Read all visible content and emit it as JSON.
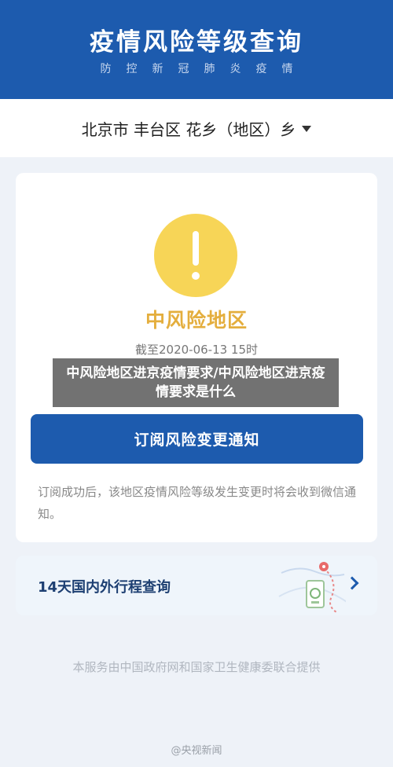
{
  "header": {
    "title": "疫情风险等级查询",
    "subtitle": "防控新冠肺炎疫情"
  },
  "location": {
    "selected": "北京市 丰台区 花乡（地区）乡"
  },
  "risk_card": {
    "level": "中风险地区",
    "as_of": "截至2020-06-13 15时",
    "subscribe_button": "订阅风险变更通知",
    "subscribe_note": "订阅成功后，该地区疫情风险等级发生变更时将会收到微信通知。"
  },
  "trip_card": {
    "label": "14天国内外行程查询"
  },
  "footer": {
    "provider": "本服务由中国政府网和国家卫生健康委联合提供"
  },
  "watermark": "@央视新闻",
  "overlay": {
    "caption": "中风险地区进京疫情要求/中风险地区进京疫情要求是什么"
  },
  "colors": {
    "brand_blue": "#1d5bae",
    "risk_yellow": "#f7d557",
    "risk_text": "#e4ae3d"
  }
}
